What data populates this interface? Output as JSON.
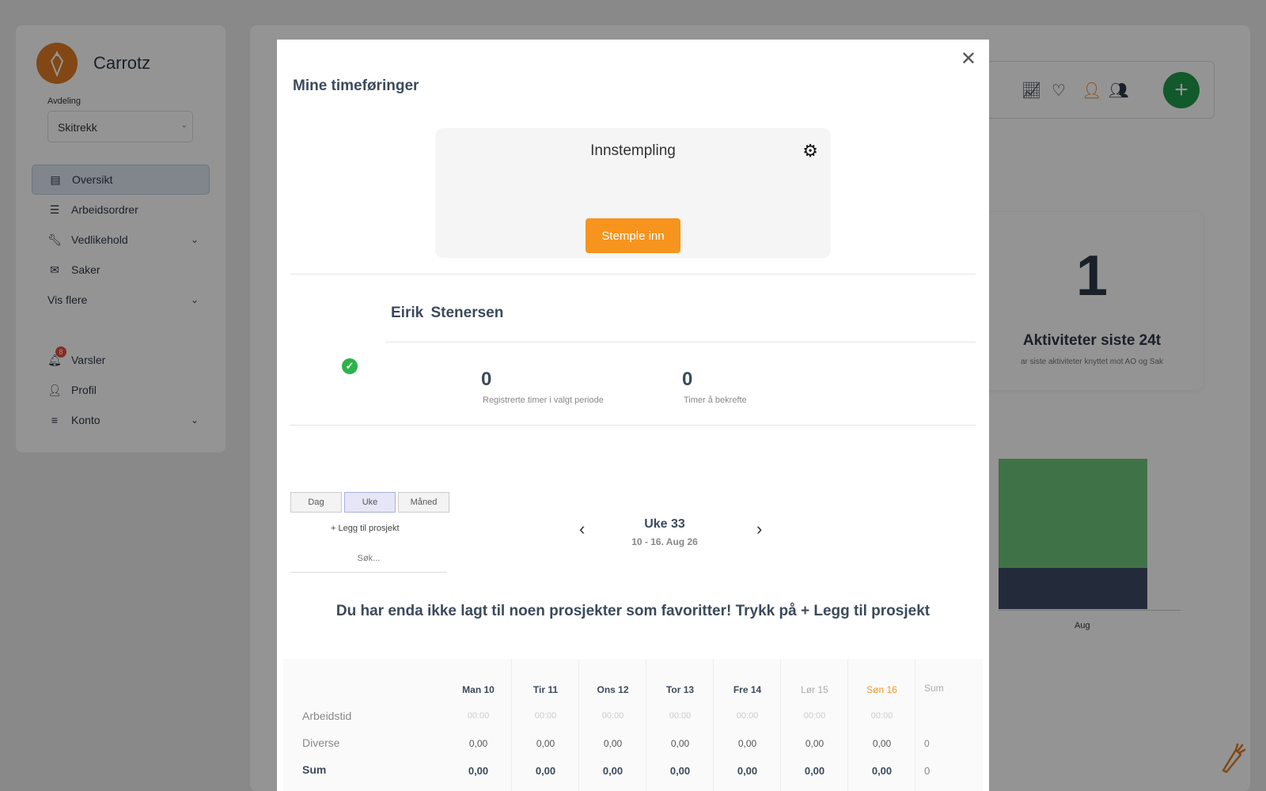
{
  "app": {
    "brand_name": "Carrotz",
    "department_label": "Avdeling",
    "department_value": "Skitrekk",
    "nav": [
      {
        "label": "Oversikt",
        "icon": "clipboard-icon",
        "active": true
      },
      {
        "label": "Arbeidsordrer",
        "icon": "list-icon"
      },
      {
        "label": "Vedlikehold",
        "icon": "wrench-icon",
        "expandable": true
      },
      {
        "label": "Saker",
        "icon": "envelope-icon"
      },
      {
        "label": "Vis flere",
        "expandable": true
      }
    ],
    "nav_bottom": [
      {
        "label": "Varsler",
        "icon": "bell-icon",
        "badge": "8"
      },
      {
        "label": "Profil",
        "icon": "user-icon"
      },
      {
        "label": "Konto",
        "icon": "menu-icon",
        "expandable": true
      }
    ],
    "stat_card": {
      "value": "1",
      "title": "Aktiviteter siste 24t",
      "subtitle": "ar siste aktiviteter knyttet mot AO og Sak"
    },
    "chart_data": {
      "type": "bar",
      "categories": [
        "Aug"
      ],
      "series": [
        {
          "values": [
            27
          ],
          "color": "#6fc47d"
        },
        {
          "values": [
            10
          ],
          "color": "#3d4b66"
        }
      ]
    },
    "colors": {
      "accent_orange": "#f7941d",
      "add_green": "#1f9a4a",
      "check_green": "#2cb34a"
    }
  },
  "modal": {
    "title": "Mine timeføringer",
    "stamp_title": "Innstempling",
    "stamp_button": "Stemple inn",
    "user_first": "Eirik",
    "user_last": "Stenersen",
    "kpi_registered_value": "0",
    "kpi_registered_label": "Registrerte timer i valgt periode",
    "kpi_confirm_value": "0",
    "kpi_confirm_label": "Timer å bekrefte",
    "view_tabs": [
      "Dag",
      "Uke",
      "Måned"
    ],
    "active_view": "Uke",
    "add_project": "+ Legg til prosjekt",
    "search_placeholder": "Søk...",
    "week_title": "Uke 33",
    "week_range": "10 - 16. Aug 26",
    "favorites_message": "Du har enda ikke lagt til noen prosjekter som favoritter! Trykk på + Legg til prosjekt",
    "grid": {
      "row_labels": [
        "Arbeidstid",
        "Diverse",
        "Sum"
      ],
      "days": [
        {
          "label": "Man 10",
          "work": "00:00",
          "misc": "0,00",
          "sum": "0,00"
        },
        {
          "label": "Tir 11",
          "work": "00:00",
          "misc": "0,00",
          "sum": "0,00"
        },
        {
          "label": "Ons 12",
          "work": "00:00",
          "misc": "0,00",
          "sum": "0,00"
        },
        {
          "label": "Tor 13",
          "work": "00:00",
          "misc": "0,00",
          "sum": "0,00"
        },
        {
          "label": "Fre 14",
          "work": "00:00",
          "misc": "0,00",
          "sum": "0,00"
        },
        {
          "label": "Lør 15",
          "work": "00:00",
          "misc": "0,00",
          "sum": "0,00"
        },
        {
          "label": "Søn 16",
          "work": "00:00",
          "misc": "0,00",
          "sum": "0,00"
        }
      ],
      "sum_header": "Sum",
      "sum_misc": "0",
      "sum_total": "0"
    }
  }
}
